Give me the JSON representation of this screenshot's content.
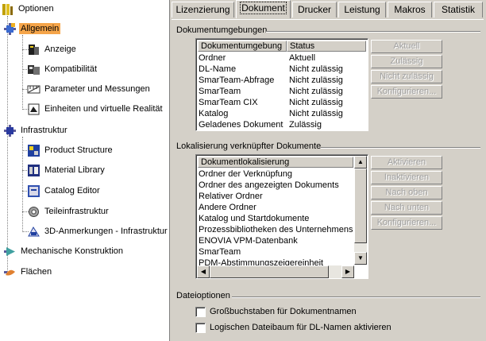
{
  "tree": {
    "root": "Optionen",
    "items": [
      {
        "label": "Allgemein",
        "icon": "general-settings-icon",
        "selected": true
      },
      {
        "label": "Anzeige",
        "icon": "display-icon"
      },
      {
        "label": "Kompatibilität",
        "icon": "compatibility-icon"
      },
      {
        "label": "Parameter und Messungen",
        "icon": "parameters-icon"
      },
      {
        "label": "Einheiten und virtuelle Realität",
        "icon": "devices-vr-icon"
      },
      {
        "label": "Infrastruktur",
        "icon": "infrastructure-icon"
      },
      {
        "label": "Product Structure",
        "icon": "product-structure-icon"
      },
      {
        "label": "Material Library",
        "icon": "material-library-icon"
      },
      {
        "label": "Catalog Editor",
        "icon": "catalog-editor-icon"
      },
      {
        "label": "Teileinfrastruktur",
        "icon": "part-infrastructure-icon"
      },
      {
        "label": "3D-Anmerkungen - Infrastruktur",
        "icon": "annotations-3d-icon"
      },
      {
        "label": "Mechanische Konstruktion",
        "icon": "mechanical-design-icon"
      },
      {
        "label": "Flächen",
        "icon": "shape-icon"
      }
    ]
  },
  "tabs": [
    "Lizenzierung",
    "Dokument",
    "Drucker",
    "Leistung",
    "Makros",
    "Statistik"
  ],
  "active_tab": "Dokument",
  "doc_env": {
    "title": "Dokumentumgebungen",
    "col_env": "Dokumentumgebung",
    "col_status": "Status",
    "rows": [
      {
        "env": "Ordner",
        "status": "Aktuell"
      },
      {
        "env": "DL-Name",
        "status": "Nicht zulässig"
      },
      {
        "env": "SmarTeam-Abfrage",
        "status": "Nicht zulässig"
      },
      {
        "env": "SmarTeam",
        "status": "Nicht zulässig"
      },
      {
        "env": "SmarTeam CIX",
        "status": "Nicht zulässig"
      },
      {
        "env": "Katalog",
        "status": "Nicht zulässig"
      },
      {
        "env": "Geladenes Dokument",
        "status": "Zulässig"
      }
    ],
    "buttons": [
      "Aktuell",
      "Zulässig",
      "Nicht zulässig",
      "Konfigurieren..."
    ]
  },
  "linked": {
    "title": "Lokalisierung verknüpfter Dokumente",
    "col": "Dokumentlokalisierung",
    "rows": [
      "Ordner der Verknüpfung",
      "Ordner des angezeigten Dokuments",
      "Relativer Ordner",
      "Andere Ordner",
      "Katalog und Startdokumente",
      "Prozessbibliotheken des Unternehmens",
      "ENOVIA VPM-Datenbank",
      "SmarTeam",
      "PDM-Abstimmungszeigereinheit"
    ],
    "buttons": [
      "Aktivieren",
      "Inaktivieren",
      "Nach oben",
      "Nach unten",
      "Konfigurieren..."
    ]
  },
  "file_options": {
    "title": "Dateioptionen",
    "options": [
      {
        "label": "Großbuchstaben für Dokumentnamen",
        "checked": false
      },
      {
        "label": "Logischen Dateibaum für DL-Namen aktivieren",
        "checked": false
      }
    ]
  }
}
